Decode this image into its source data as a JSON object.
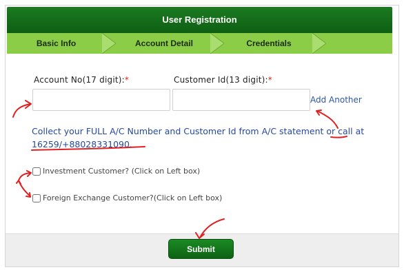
{
  "header": {
    "title": "User Registration"
  },
  "steps": [
    {
      "label": "Basic Info"
    },
    {
      "label": "Account Detail"
    },
    {
      "label": "Credentials"
    }
  ],
  "form": {
    "account_no": {
      "label": "Account No(17 digit):",
      "required_mark": "*",
      "value": "",
      "placeholder": ""
    },
    "customer_id": {
      "label": "Customer Id(13 digit):",
      "required_mark": "*",
      "value": "",
      "placeholder": ""
    },
    "add_another_label": "Add Another",
    "info_text": "Collect your FULL A/C Number and Customer Id from A/C statement or call at 16259/+88028331090.",
    "investment_label": "Investment Customer? (Click on Left box)",
    "foreign_exchange_label": "Foreign Exchange Customer?(Click on Left box)"
  },
  "footer": {
    "submit_label": "Submit"
  },
  "colors": {
    "header_green": "#0e5f13",
    "steps_green": "#8ccd48",
    "info_blue": "#2448a0",
    "required_red": "#d9231c",
    "annotation_red": "#e02020"
  }
}
